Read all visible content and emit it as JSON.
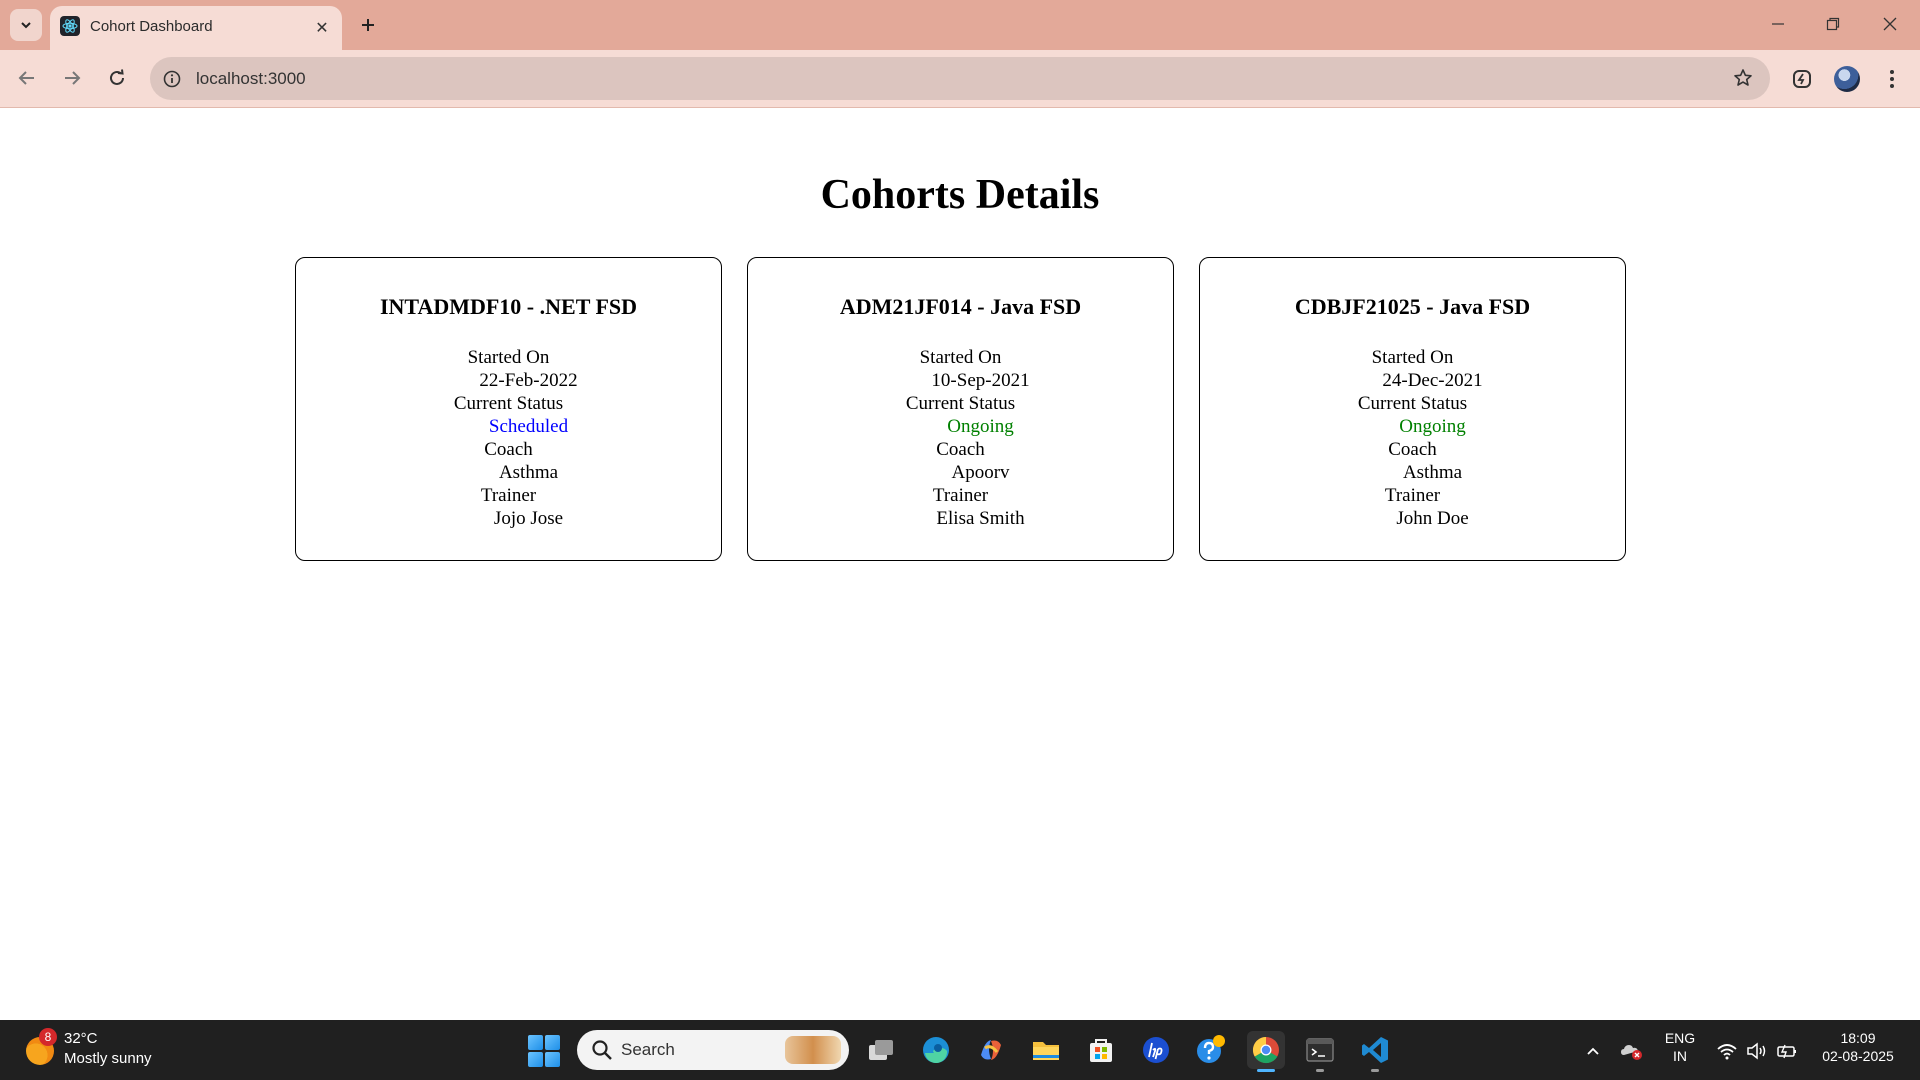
{
  "browser": {
    "tab_title": "Cohort Dashboard",
    "url": "localhost:3000",
    "icons": {
      "tab_list": "chevron-down-icon",
      "favicon": "react-icon",
      "tab_close": "close-icon",
      "new_tab": "plus-icon",
      "back": "arrow-left-icon",
      "forward": "arrow-right-icon",
      "reload": "reload-icon",
      "site_info": "info-icon",
      "bookmark": "star-icon",
      "extension": "extension-icon",
      "profile": "avatar"
    },
    "colors": {
      "tabstrip": "#e3a999",
      "toolbar": "#f6dcd5",
      "omnibox": "#dcc5bf"
    }
  },
  "page": {
    "title": "Cohorts Details",
    "cohorts": [
      {
        "name": "INTADMDF10 - .NET FSD",
        "started_label": "Started On",
        "started_value": "22-Feb-2022",
        "status_label": "Current Status",
        "status_value": "Scheduled",
        "status_color": "#0000ff",
        "coach_label": "Coach",
        "coach_value": "Asthma",
        "trainer_label": "Trainer",
        "trainer_value": "Jojo Jose"
      },
      {
        "name": "ADM21JF014 - Java FSD",
        "started_label": "Started On",
        "started_value": "10-Sep-2021",
        "status_label": "Current Status",
        "status_value": "Ongoing",
        "status_color": "#008000",
        "coach_label": "Coach",
        "coach_value": "Apoorv",
        "trainer_label": "Trainer",
        "trainer_value": "Elisa Smith"
      },
      {
        "name": "CDBJF21025 - Java FSD",
        "started_label": "Started On",
        "started_value": "24-Dec-2021",
        "status_label": "Current Status",
        "status_value": "Ongoing",
        "status_color": "#008000",
        "coach_label": "Coach",
        "coach_value": "Asthma",
        "trainer_label": "Trainer",
        "trainer_value": "John Doe"
      }
    ]
  },
  "taskbar": {
    "weather": {
      "badge": "8",
      "temp": "32°C",
      "desc": "Mostly sunny",
      "icon": "weather-sun-icon"
    },
    "search_label": "Search",
    "apps": [
      {
        "name": "task-view",
        "icon": "task-view-icon"
      },
      {
        "name": "edge",
        "icon": "edge-icon"
      },
      {
        "name": "copilot",
        "icon": "copilot-icon"
      },
      {
        "name": "file-explorer",
        "icon": "folder-icon"
      },
      {
        "name": "store",
        "icon": "store-icon"
      },
      {
        "name": "hp",
        "icon": "hp-icon"
      },
      {
        "name": "help",
        "icon": "help-icon"
      },
      {
        "name": "chrome",
        "icon": "chrome-icon"
      },
      {
        "name": "terminal",
        "icon": "terminal-icon"
      },
      {
        "name": "vscode",
        "icon": "vscode-icon"
      }
    ],
    "tray": {
      "lang_line1": "ENG",
      "lang_line2": "IN",
      "time": "18:09",
      "date": "02-08-2025"
    }
  }
}
